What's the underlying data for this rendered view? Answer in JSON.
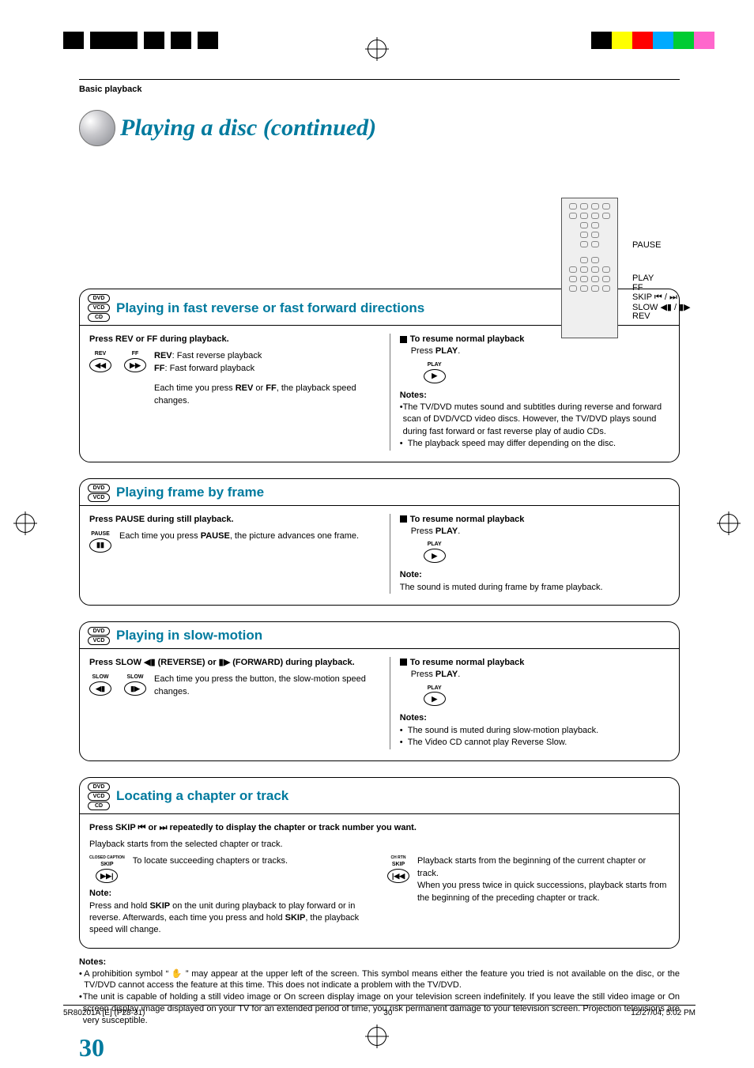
{
  "breadcrumb": "Basic playback",
  "page_title": "Playing a disc (continued)",
  "remote": {
    "pause": "PAUSE",
    "play": "PLAY",
    "ff": "FF",
    "skip": "SKIP ⏮ / ⏭",
    "slow": "SLOW ◀▮ / ▮▶",
    "rev": "REV"
  },
  "s1": {
    "badges": {
      "dvd": "DVD",
      "vcd": "VCD",
      "cd": "CD"
    },
    "title": "Playing in fast reverse or fast forward directions",
    "step": "Press REV or FF during playback.",
    "icon_rev": "REV",
    "icon_ff": "FF",
    "rev_lbl": "REV",
    "rev_txt": ":  Fast reverse playback",
    "ff_lbl": "FF",
    "ff_txt": ":    Fast forward playback",
    "each_a": "Each time you press ",
    "each_b": "REV",
    "each_c": " or ",
    "each_d": "FF",
    "each_e": ", the playback speed changes.",
    "resume_h": "To resume normal playback",
    "resume_a": "Press ",
    "resume_b": "PLAY",
    "resume_c": ".",
    "play_icon": "PLAY",
    "notes_h": "Notes:",
    "note1": "The TV/DVD mutes sound and subtitles during reverse and forward scan of DVD/VCD video discs. However, the TV/DVD plays sound during fast forward or fast reverse play of audio CDs.",
    "note2": "The playback speed may differ depending on the disc."
  },
  "s2": {
    "badges": {
      "dvd": "DVD",
      "vcd": "VCD"
    },
    "title": "Playing frame by frame",
    "step": "Press PAUSE during still playback.",
    "icon_lbl": "PAUSE",
    "each_a": "Each time you press ",
    "each_b": "PAUSE",
    "each_c": ", the picture advances one frame.",
    "resume_h": "To resume normal playback",
    "resume_a": "Press ",
    "resume_b": "PLAY",
    "resume_c": ".",
    "play_icon": "PLAY",
    "note_h": "Note:",
    "note1": "The sound is muted during frame by frame playback."
  },
  "s3": {
    "badges": {
      "dvd": "DVD",
      "vcd": "VCD"
    },
    "title": "Playing in slow-motion",
    "step": "Press SLOW ◀▮ (REVERSE) or ▮▶ (FORWARD) during playback.",
    "icon_slow": "SLOW",
    "each": "Each time you press the button, the slow-motion speed changes.",
    "resume_h": "To resume normal playback",
    "resume_a": "Press ",
    "resume_b": "PLAY",
    "resume_c": ".",
    "play_icon": "PLAY",
    "notes_h": "Notes:",
    "note1": "The sound is muted during slow-motion playback.",
    "note2": "The Video CD cannot play Reverse Slow."
  },
  "s4": {
    "badges": {
      "dvd": "DVD",
      "vcd": "VCD",
      "cd": "CD"
    },
    "title": "Locating a chapter or track",
    "step": "Press SKIP ⏮ or ⏭ repeatedly to display the chapter or track number you want.",
    "sub": "Playback starts from the selected chapter or track.",
    "col1_icon_top": "CLOSED CAPTION",
    "col1_icon_mid": "SKIP",
    "col1_txt": "To locate succeeding chapters or tracks.",
    "note_h": "Note:",
    "note_a": "Press and hold ",
    "note_b": "SKIP",
    "note_c": " on the unit during playback to play forward or in reverse. Afterwards, each time you press and hold ",
    "note_d": "SKIP",
    "note_e": ", the playback speed will change.",
    "col2_icon_top": "CH RTN",
    "col2_icon_mid": "SKIP",
    "col2_txt": "Playback starts from the beginning of the current chapter or track.",
    "col2_txt2": "When you press twice in quick successions, playback starts from the beginning of the preceding chapter or track."
  },
  "final_notes": {
    "h": "Notes:",
    "n1": "A prohibition symbol “ ✋ ” may appear at the upper left of the screen. This symbol means either the feature you tried is not available on the disc, or the TV/DVD cannot access the feature at this time. This does not indicate a problem with the TV/DVD.",
    "n2": "The unit is capable of holding a still video image or On screen display image on your television screen indefinitely. If you leave the still video image or On screen display image displayed on your TV for an extended period of time, you risk permanent damage to your television screen. Projection televisions are very susceptible."
  },
  "page_number": "30",
  "footer": {
    "left": "5R80201A [E] (P28-31)",
    "mid": "30",
    "right": "12/27/04, 5:02 PM"
  },
  "colors": {
    "bar1": "#ff00ff",
    "bar2": "#000000",
    "bar3": "#ffff00",
    "bar4": "#ff0000",
    "bar5": "#00aaff",
    "bar6": "#00cc33",
    "bar7": "#ff66cc"
  }
}
